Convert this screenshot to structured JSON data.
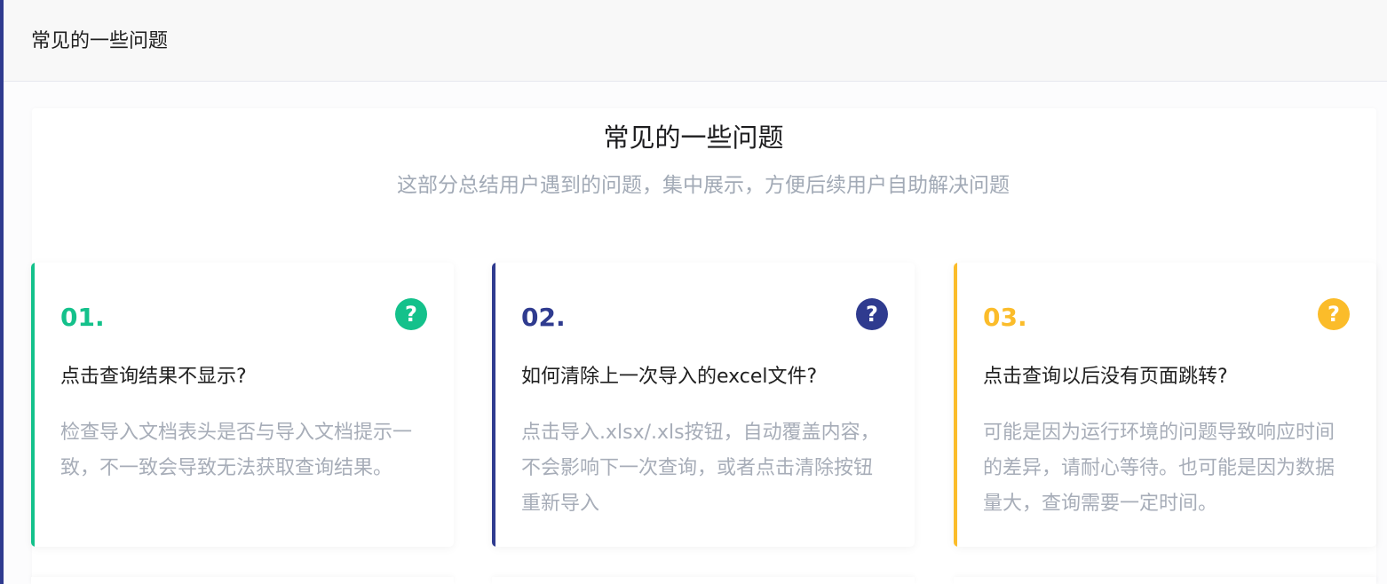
{
  "header": {
    "title": "常见的一些问题"
  },
  "section": {
    "title": "常见的一些问题",
    "subtitle": "这部分总结用户遇到的问题，集中展示，方便后续用户自助解决问题"
  },
  "colors": {
    "green": "#14c18b",
    "navy": "#2f3b8f",
    "yellow": "#fbbc2a",
    "accent_left": "#2f3b8f"
  },
  "cards": [
    {
      "number": "01.",
      "icon": "question-circle-icon",
      "question": "点击查询结果不显示?",
      "answer": "检查导入文档表头是否与导入文档提示一致，不一致会导致无法获取查询结果。"
    },
    {
      "number": "02.",
      "icon": "question-circle-icon",
      "question": "如何清除上一次导入的excel文件?",
      "answer": "点击导入.xlsx/.xls按钮，自动覆盖内容，不会影响下一次查询，或者点击清除按钮重新导入"
    },
    {
      "number": "03.",
      "icon": "question-circle-icon",
      "question": "点击查询以后没有页面跳转?",
      "answer": "可能是因为运行环境的问题导致响应时间的差异，请耐心等待。也可能是因为数据量大，查询需要一定时间。"
    }
  ]
}
